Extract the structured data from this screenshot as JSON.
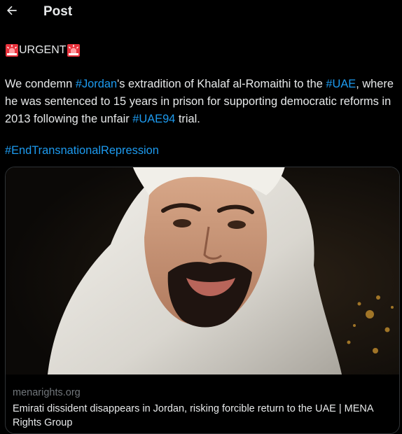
{
  "header": {
    "back_icon": "arrow-left-icon",
    "title": "Post"
  },
  "post": {
    "urgent_label": "URGENT",
    "siren_icon": "police-car-light-emoji",
    "text_parts": {
      "p1": "We condemn ",
      "tag_jordan": "#Jordan",
      "p2": "'s extradition of Khalaf al-Romaithi to the ",
      "tag_uae": "#UAE",
      "p3": ", where he was sentenced to 15 years in prison for supporting democratic reforms in 2013 following the unfair ",
      "tag_uae94": "#UAE94",
      "p4": " trial."
    },
    "hashtag_line": "#EndTransnationalRepression"
  },
  "link_card": {
    "domain": "menarights.org",
    "title": "Emirati dissident disappears in Jordan, risking forcible return to the UAE | MENA Rights Group"
  },
  "colors": {
    "background": "#000000",
    "text": "#e7e9ea",
    "link": "#1d9bf0",
    "muted": "#71767b",
    "border": "#2f3336",
    "siren": "#e8323c"
  }
}
